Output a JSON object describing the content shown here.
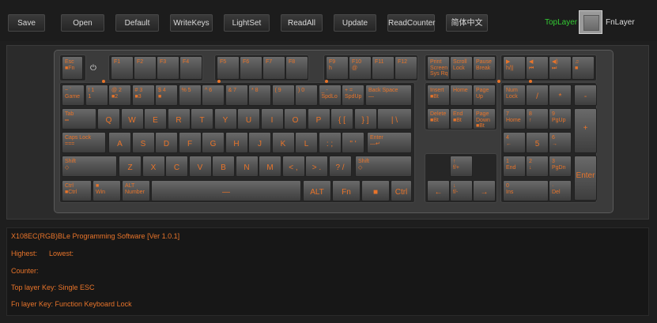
{
  "toolbar": {
    "buttons": [
      "Save",
      "Open",
      "Default",
      "WriteKeys",
      "LightSet",
      "ReadAll",
      "Update",
      "ReadCounter",
      "简体中文"
    ]
  },
  "layers": {
    "top_label": "TopLayer",
    "fn_label": "FnLayer",
    "top_color": "#33cc33"
  },
  "accent_color": "#e8742a",
  "keyboard": {
    "power_icon": "⏻",
    "keys": [
      {
        "id": "esc",
        "label": "Esc\n■Fn"
      },
      {
        "id": "f1",
        "label": "F1"
      },
      {
        "id": "f2",
        "label": "F2"
      },
      {
        "id": "f3",
        "label": "F3"
      },
      {
        "id": "f4",
        "label": "F4"
      },
      {
        "id": "f5",
        "label": "F5"
      },
      {
        "id": "f6",
        "label": "F6"
      },
      {
        "id": "f7",
        "label": "F7"
      },
      {
        "id": "f8",
        "label": "F8"
      },
      {
        "id": "f9",
        "label": "F9\nh"
      },
      {
        "id": "f10",
        "label": "F10\n@"
      },
      {
        "id": "f11",
        "label": "F11"
      },
      {
        "id": "f12",
        "label": "F12"
      },
      {
        "id": "prtsc",
        "label": "Print\nScreen\nSys Rq"
      },
      {
        "id": "scrlk",
        "label": "Scroll\nLock"
      },
      {
        "id": "pause",
        "label": "Pause\nBreak"
      },
      {
        "id": "m1",
        "label": "▶\nh/||"
      },
      {
        "id": "m2",
        "label": "◀\n⏮"
      },
      {
        "id": "m3",
        "label": "◀)\n⏭"
      },
      {
        "id": "m4",
        "label": "♫\n■"
      },
      {
        "id": "grave",
        "label": "~ `\nGame"
      },
      {
        "id": "n1",
        "label": "! 1\n1"
      },
      {
        "id": "n2",
        "label": "@ 2\n■2"
      },
      {
        "id": "n3",
        "label": "# 3\n■3"
      },
      {
        "id": "n4",
        "label": "$ 4\n■"
      },
      {
        "id": "n5",
        "label": "% 5"
      },
      {
        "id": "n6",
        "label": "^ 6"
      },
      {
        "id": "n7",
        "label": "& 7"
      },
      {
        "id": "n8",
        "label": "* 8"
      },
      {
        "id": "n9",
        "label": "( 9"
      },
      {
        "id": "n0",
        "label": ") 0"
      },
      {
        "id": "minus",
        "label": "_ -\nSpdLo"
      },
      {
        "id": "equal",
        "label": "+ =\nSpdUp"
      },
      {
        "id": "bksp",
        "label": "Back Space\n—"
      },
      {
        "id": "ins",
        "label": "Insert\n■Bt"
      },
      {
        "id": "home",
        "label": "Home"
      },
      {
        "id": "pgup",
        "label": "Page\nUp"
      },
      {
        "id": "numlk",
        "label": "Num\nLock"
      },
      {
        "id": "kpslash",
        "label": "/"
      },
      {
        "id": "kpstar",
        "label": "*"
      },
      {
        "id": "kpminus",
        "label": "-"
      },
      {
        "id": "tab",
        "label": "Tab\n═"
      },
      {
        "id": "q",
        "label": "Q"
      },
      {
        "id": "w",
        "label": "W"
      },
      {
        "id": "e",
        "label": "E"
      },
      {
        "id": "r",
        "label": "R"
      },
      {
        "id": "t",
        "label": "T"
      },
      {
        "id": "y",
        "label": "Y"
      },
      {
        "id": "u",
        "label": "U"
      },
      {
        "id": "i",
        "label": "I"
      },
      {
        "id": "o",
        "label": "O"
      },
      {
        "id": "p",
        "label": "P"
      },
      {
        "id": "lbr",
        "label": "{ ["
      },
      {
        "id": "rbr",
        "label": "} ]"
      },
      {
        "id": "bslash",
        "label": "| \\"
      },
      {
        "id": "del",
        "label": "Delete\n■Bt"
      },
      {
        "id": "end",
        "label": "End\n■Bt"
      },
      {
        "id": "pgdn",
        "label": "Page\nDown\n■Bt"
      },
      {
        "id": "kp7",
        "label": "7\nHome"
      },
      {
        "id": "kp8",
        "label": "8\n↑"
      },
      {
        "id": "kp9",
        "label": "9\nPgUp"
      },
      {
        "id": "kpplus",
        "label": "+"
      },
      {
        "id": "caps",
        "label": "Caps Lock\n==="
      },
      {
        "id": "a",
        "label": "A"
      },
      {
        "id": "s",
        "label": "S"
      },
      {
        "id": "d",
        "label": "D"
      },
      {
        "id": "f",
        "label": "F"
      },
      {
        "id": "g",
        "label": "G"
      },
      {
        "id": "h",
        "label": "H"
      },
      {
        "id": "j",
        "label": "J"
      },
      {
        "id": "k",
        "label": "K"
      },
      {
        "id": "l",
        "label": "L"
      },
      {
        "id": "semi",
        "label": ": ;"
      },
      {
        "id": "quote",
        "label": "\" '"
      },
      {
        "id": "enter",
        "label": "Enter\n—↵"
      },
      {
        "id": "kp4",
        "label": "4\n←"
      },
      {
        "id": "kp5",
        "label": "5"
      },
      {
        "id": "kp6",
        "label": "6\n→"
      },
      {
        "id": "lshift",
        "label": "Shift\n◇"
      },
      {
        "id": "z",
        "label": "Z"
      },
      {
        "id": "x",
        "label": "X"
      },
      {
        "id": "c",
        "label": "C"
      },
      {
        "id": "v",
        "label": "V"
      },
      {
        "id": "b",
        "label": "B"
      },
      {
        "id": "n",
        "label": "N"
      },
      {
        "id": "m",
        "label": "M"
      },
      {
        "id": "comma",
        "label": "< ,"
      },
      {
        "id": "period",
        "label": "> ."
      },
      {
        "id": "slash",
        "label": "? /"
      },
      {
        "id": "rshift",
        "label": "Shift\n◇"
      },
      {
        "id": "up",
        "label": "↑\nf/+"
      },
      {
        "id": "kp1",
        "label": "1\nEnd"
      },
      {
        "id": "kp2",
        "label": "2\n↓"
      },
      {
        "id": "kp3",
        "label": "3\nPgDn"
      },
      {
        "id": "kpenter",
        "label": "Enter"
      },
      {
        "id": "lctrl",
        "label": "Ctrl\n■Ctrl"
      },
      {
        "id": "lwin",
        "label": "■\nWin"
      },
      {
        "id": "lalt",
        "label": "ALT\nNumber"
      },
      {
        "id": "space",
        "label": "—"
      },
      {
        "id": "ralt",
        "label": "ALT"
      },
      {
        "id": "fn",
        "label": "Fn"
      },
      {
        "id": "menu",
        "label": "■"
      },
      {
        "id": "rctrl",
        "label": "Ctrl"
      },
      {
        "id": "left",
        "label": "←"
      },
      {
        "id": "down",
        "label": "↓\nf/-"
      },
      {
        "id": "right",
        "label": "→"
      },
      {
        "id": "kp0",
        "label": "0\nIns"
      },
      {
        "id": "kpdot",
        "label": "·\nDel"
      }
    ]
  },
  "status": {
    "lines": [
      "X108EC(RGB)BLe Programming Software [Ver 1.0.1]",
      "Highest:      Lowest:",
      "Counter:",
      "Top layer Key: Single ESC",
      "Fn layer Key: Function Keyboard Lock"
    ]
  }
}
